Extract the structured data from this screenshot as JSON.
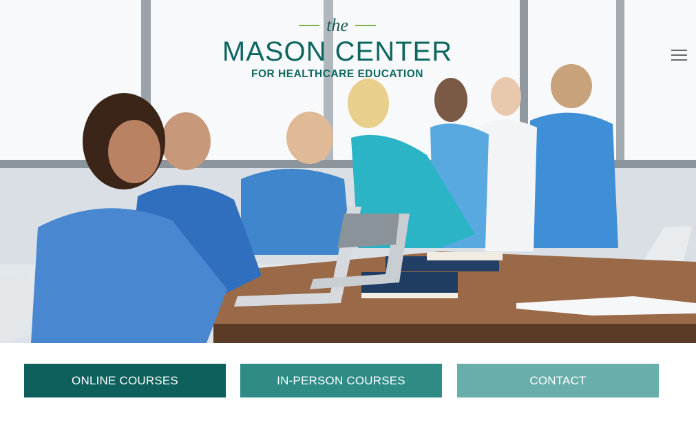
{
  "logo": {
    "the": "the",
    "main": "MASON CENTER",
    "sub": "FOR HEALTHCARE EDUCATION"
  },
  "hero": {
    "image_icon": "students-in-scrubs-with-laptops-photo"
  },
  "nav": {
    "menu_icon": "hamburger-menu-icon"
  },
  "buttons": {
    "online": "ONLINE COURSES",
    "in_person": "IN-PERSON COURSES",
    "contact": "CONTACT"
  },
  "colors": {
    "brand_dark": "#0d605b",
    "brand_mid": "#2e8b86",
    "brand_light": "#69aeaa",
    "accent_green": "#7cb342"
  }
}
